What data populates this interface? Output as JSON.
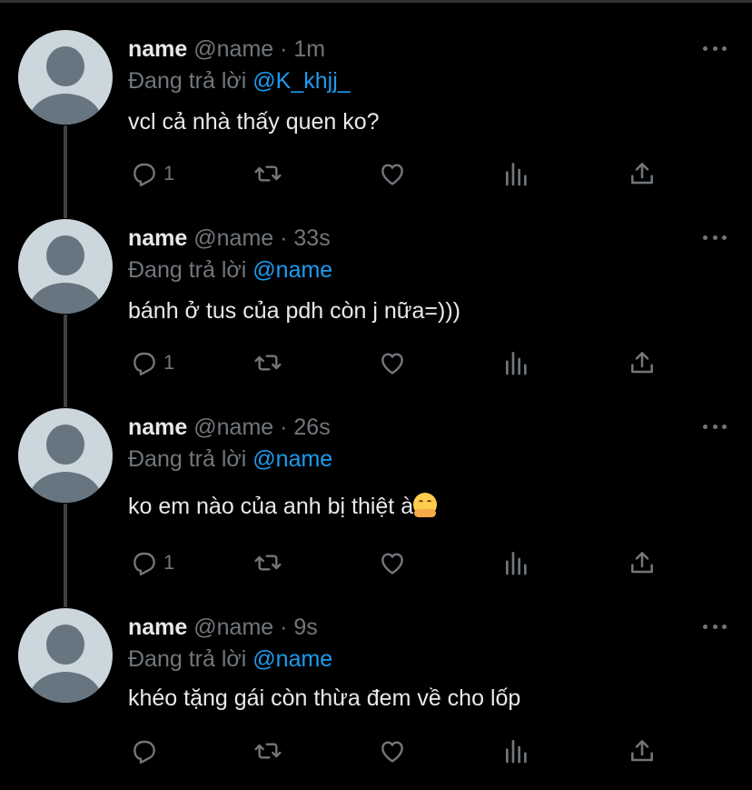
{
  "theme": {
    "background": "#000000",
    "text": "#e7e9ea",
    "muted": "#71767b",
    "link": "#1d9bf0"
  },
  "labels": {
    "replying_to": "Đang trả lời"
  },
  "tweets": [
    {
      "display_name": "name",
      "meta": "@name · 1m",
      "reply_handle": "@K_khjj_",
      "text": "vcl cả nhà thấy quen ko?",
      "reply_count": "1",
      "emoji": ""
    },
    {
      "display_name": "name",
      "meta": "@name · 33s",
      "reply_handle": "@name",
      "text": "bánh ở tus của pdh còn j nữa=)))",
      "reply_count": "1",
      "emoji": ""
    },
    {
      "display_name": "name",
      "meta": "@name · 26s",
      "reply_handle": "@name",
      "text": "ko em nào của anh bị thiệt à",
      "reply_count": "1",
      "emoji": "hugging-face-emoji"
    },
    {
      "display_name": "name",
      "meta": "@name · 9s",
      "reply_handle": "@name",
      "text": "khéo tặng gái còn thừa đem về cho lốp",
      "reply_count": "",
      "emoji": ""
    }
  ],
  "icons": [
    "reply-icon",
    "retweet-icon",
    "like-icon",
    "analytics-icon",
    "share-icon",
    "more-icon"
  ]
}
